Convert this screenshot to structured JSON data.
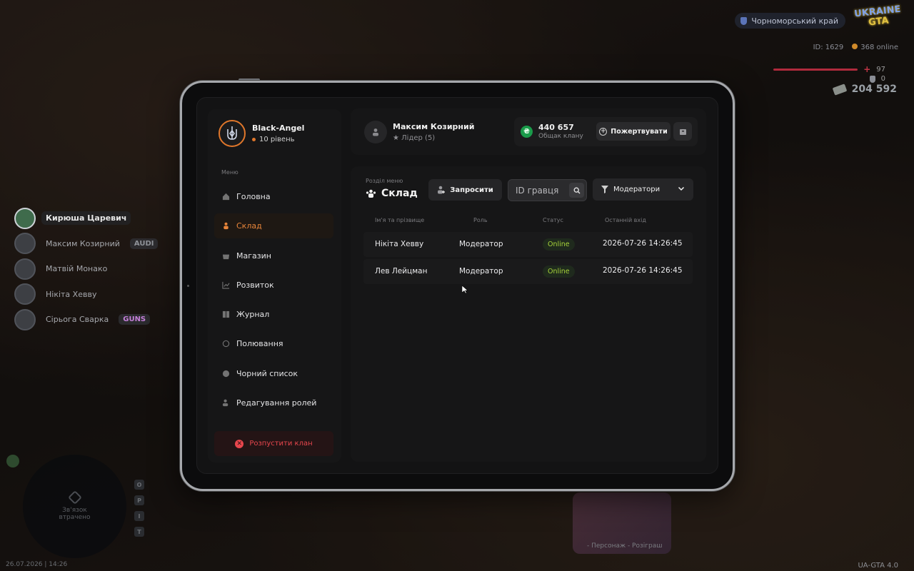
{
  "hud": {
    "region": "Чорноморський край",
    "logo_line1": "UKRAINE",
    "logo_line2": "GTA",
    "player_id": "ID: 1629",
    "online": "368 online",
    "health": "97",
    "armor": "0",
    "money": "204 592",
    "version": "UA-GTA 4.0",
    "datetime": "26.07.2026 | 14:26",
    "minimap_text": "Зв'язок втрачено",
    "promo_caption": "- Персонаж - Розіграш"
  },
  "players": [
    {
      "name": "Кирюша Царевич",
      "tag": ""
    },
    {
      "name": "Максим Козирний",
      "tag": "AUDI"
    },
    {
      "name": "Матвій Монако",
      "tag": ""
    },
    {
      "name": "Нікіта Хевву",
      "tag": ""
    },
    {
      "name": "Сірьога Сварка",
      "tag": "GUNS"
    }
  ],
  "clan": {
    "name": "Black-Angel",
    "level": "10 рівень"
  },
  "menu": {
    "caption": "Меню",
    "items": [
      {
        "label": "Головна",
        "icon": "home-icon"
      },
      {
        "label": "Склад",
        "icon": "people-icon",
        "active": true
      },
      {
        "label": "Магазин",
        "icon": "basket-icon"
      },
      {
        "label": "Розвиток",
        "icon": "chart-icon"
      },
      {
        "label": "Журнал",
        "icon": "book-icon"
      },
      {
        "label": "Полювання",
        "icon": "target-icon"
      },
      {
        "label": "Чорний список",
        "icon": "block-icon"
      },
      {
        "label": "Редагування ролей",
        "icon": "user-edit-icon"
      }
    ],
    "disband": "Розпустити клан"
  },
  "leader": {
    "name": "Максим Козирний",
    "role": "Лідер (5)"
  },
  "bank": {
    "amount": "440 657",
    "caption": "Общак клану",
    "currency_symbol": "₴",
    "donate": "Пожертвувати"
  },
  "section": {
    "caption": "Розділ меню",
    "title": "Склад",
    "invite": "Запросити",
    "search_placeholder": "ID гравця",
    "filter": "Модератори"
  },
  "table": {
    "headers": [
      "Ім'я та прізвище",
      "Роль",
      "Статус",
      "Останній вхід"
    ],
    "rows": [
      {
        "name": "Нікіта Хевву",
        "role": "Модератор",
        "status": "Online",
        "last": "2026-07-26 14:26:45"
      },
      {
        "name": "Лев Лейцман",
        "role": "Модератор",
        "status": "Online",
        "last": "2026-07-26 14:26:45"
      }
    ]
  },
  "colors": {
    "accent": "#e0772b",
    "danger": "#e8464d",
    "online": "#a6d33a",
    "money": "#1a9b4a"
  }
}
